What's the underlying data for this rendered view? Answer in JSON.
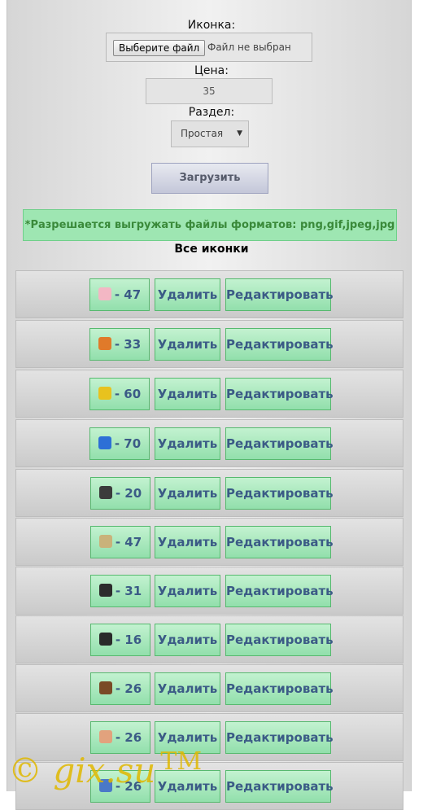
{
  "form": {
    "icon_label": "Иконка:",
    "file_button": "Выберите файл",
    "file_status": "Файл не выбран",
    "price_label": "Цена:",
    "price_value": "35",
    "section_label": "Раздел:",
    "section_value": "Простая",
    "upload_button": "Загрузить"
  },
  "notice": "*Разрешается выгружать файлы форматов: png,gif,jpeg,jpg",
  "list_title": "Все иконки",
  "delete_label": "Удалить",
  "edit_label": "Редактировать",
  "icons": [
    {
      "price": "- 47",
      "icon": "girl-avatar-icon",
      "color": "#f3b7c4"
    },
    {
      "price": "- 33",
      "icon": "tiger-face-icon",
      "color": "#e07a2a"
    },
    {
      "price": "- 60",
      "icon": "gold-coins-icon",
      "color": "#e8c21e"
    },
    {
      "price": "- 70",
      "icon": "ukraine-heart-icon",
      "color": "#2d6fd6"
    },
    {
      "price": "- 20",
      "icon": "soldier-avatar-icon",
      "color": "#3b3b3b"
    },
    {
      "price": "- 47",
      "icon": "safari-hat-avatar-icon",
      "color": "#c9b27a"
    },
    {
      "price": "- 31",
      "icon": "witch-avatar-icon",
      "color": "#2c2c2c"
    },
    {
      "price": "- 16",
      "icon": "dark-hair-avatar-icon",
      "color": "#2a2a2a"
    },
    {
      "price": "- 26",
      "icon": "long-hair-avatar-icon",
      "color": "#7a4a26"
    },
    {
      "price": "- 26",
      "icon": "bun-hair-avatar-icon",
      "color": "#e2a27d"
    },
    {
      "price": "- 26",
      "icon": "blue-dress-avatar-icon",
      "color": "#4a78c8"
    }
  ],
  "watermark": "© gix.su",
  "watermark_tm": "TM"
}
